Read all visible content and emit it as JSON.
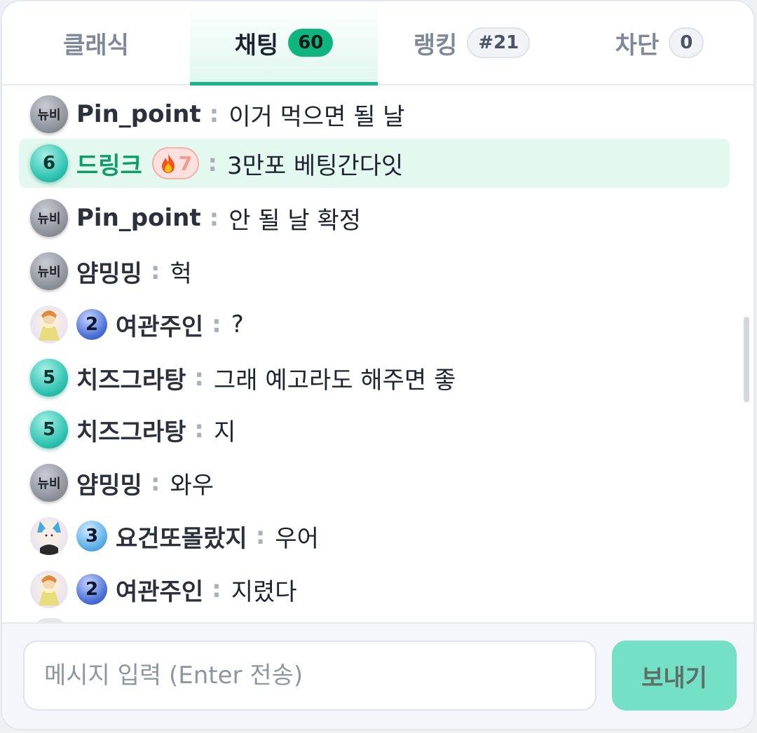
{
  "tabs": [
    {
      "label": "클래식",
      "badge": null
    },
    {
      "label": "채팅",
      "badge": "60"
    },
    {
      "label": "랭킹",
      "badge": "#21"
    },
    {
      "label": "차단",
      "badge": "0"
    }
  ],
  "messages": [
    {
      "level": "뉴비",
      "nick": "Pin_point",
      "text": "이거 먹으면 될 날"
    },
    {
      "level": "6",
      "nick": "드링크",
      "fire": "7",
      "text": "3만포 베팅간다잇",
      "highlight": true
    },
    {
      "level": "뉴비",
      "nick": "Pin_point",
      "text": "안 될 날 확정"
    },
    {
      "level": "뉴비",
      "nick": "얌밍밍",
      "text": "헉"
    },
    {
      "level": "2",
      "nick": "여관주인",
      "text": "?"
    },
    {
      "level": "5",
      "nick": "치즈그라탕",
      "text": "그래 예고라도 해주면 좋"
    },
    {
      "level": "5",
      "nick": "치즈그라탕",
      "text": "지"
    },
    {
      "level": "뉴비",
      "nick": "얌밍밍",
      "text": "와우"
    },
    {
      "level": "3",
      "nick": "요건또몰랐지",
      "text": "우어"
    },
    {
      "level": "2",
      "nick": "여관주인",
      "text": "지렸다"
    }
  ],
  "separator": ":",
  "composer": {
    "placeholder": "메시지 입력 (Enter 전송)",
    "send_label": "보내기"
  },
  "colors": {
    "accent": "#18b58a",
    "send_button": "#74e0c6",
    "highlight_row": "#e3f8ef"
  }
}
